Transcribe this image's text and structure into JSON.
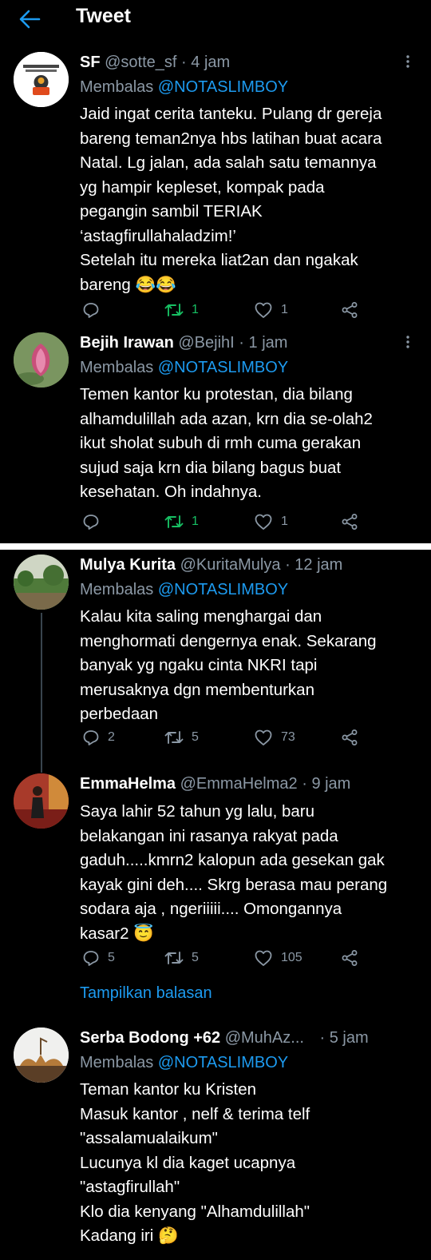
{
  "header": {
    "title": "Tweet",
    "back_icon": "arrow-left-icon",
    "accent": "#1d9bf0"
  },
  "tweets_top": [
    {
      "name": "SF",
      "handle": "@sotte_sf",
      "time": "4 jam",
      "reply_prefix": "Membalas",
      "reply_to": "@NOTASLIMBOY",
      "lines": [
        "Jaid ingat cerita tanteku. Pulang dr gereja",
        "bareng teman2nya hbs latihan buat acara",
        "Natal. Lg jalan, ada salah satu temannya",
        "yg hampir kepleset, kompak pada",
        "pegangin sambil TERIAK",
        "‘astagfirullahaladzim!’",
        "Setelah itu mereka liat2an dan ngakak",
        "bareng 😂😂"
      ],
      "replies": "",
      "retweets": "1",
      "likes": "1"
    },
    {
      "name": "Bejih Irawan",
      "handle": "@BejihI",
      "time": "1 jam",
      "reply_prefix": "Membalas",
      "reply_to": "@NOTASLIMBOY",
      "lines": [
        "Temen kantor ku protestan, dia bilang",
        "alhamdulillah ada azan, krn dia se-olah2",
        "ikut sholat subuh di rmh cuma gerakan",
        "sujud saja krn dia bilang bagus buat",
        "kesehatan. Oh indahnya."
      ],
      "replies": "",
      "retweets": "1",
      "likes": "1"
    }
  ],
  "tweets_bottom": [
    {
      "name": "Mulya Kurita",
      "handle": "@KuritaMulya",
      "time": "12 jam",
      "reply_prefix": "Membalas",
      "reply_to": "@NOTASLIMBOY",
      "lines": [
        "Kalau kita saling menghargai dan",
        "menghormati dengernya enak. Sekarang",
        "banyak yg ngaku  cinta NKRI tapi",
        "merusaknya dgn membenturkan",
        "perbedaan"
      ],
      "replies": "2",
      "retweets": "5",
      "likes": "73"
    },
    {
      "name": "EmmaHelma",
      "handle": "@EmmaHelma2",
      "time": "9 jam",
      "lines": [
        "Saya lahir 52 tahun yg lalu, baru",
        "belakangan ini rasanya rakyat pada",
        "gaduh.....kmrn2 kalopun ada gesekan gak",
        "kayak gini deh.... Skrg berasa mau perang",
        "sodara aja , ngeriiiii.... Omongannya",
        "kasar2 😇"
      ],
      "replies": "5",
      "retweets": "5",
      "likes": "105",
      "show_replies": "Tampilkan balasan"
    },
    {
      "name": "Serba Bodong +62",
      "handle": "@MuhAz...",
      "time": "5 jam",
      "reply_prefix": "Membalas",
      "reply_to": "@NOTASLIMBOY",
      "lines": [
        "Teman kantor ku Kristen",
        "Masuk kantor , nelf & terima telf",
        "\"assalamualaikum\"",
        "Lucunya kl dia kaget ucapnya",
        "\"astagfirullah\"",
        "Klo dia kenyang \"Alhamdulillah\"",
        "Kadang iri 🤔"
      ]
    }
  ],
  "sep": "·",
  "colors": {
    "background": "#000000",
    "muted": "#8b98a5",
    "retweet_active": "#17bf63",
    "link": "#1d9bf0"
  }
}
